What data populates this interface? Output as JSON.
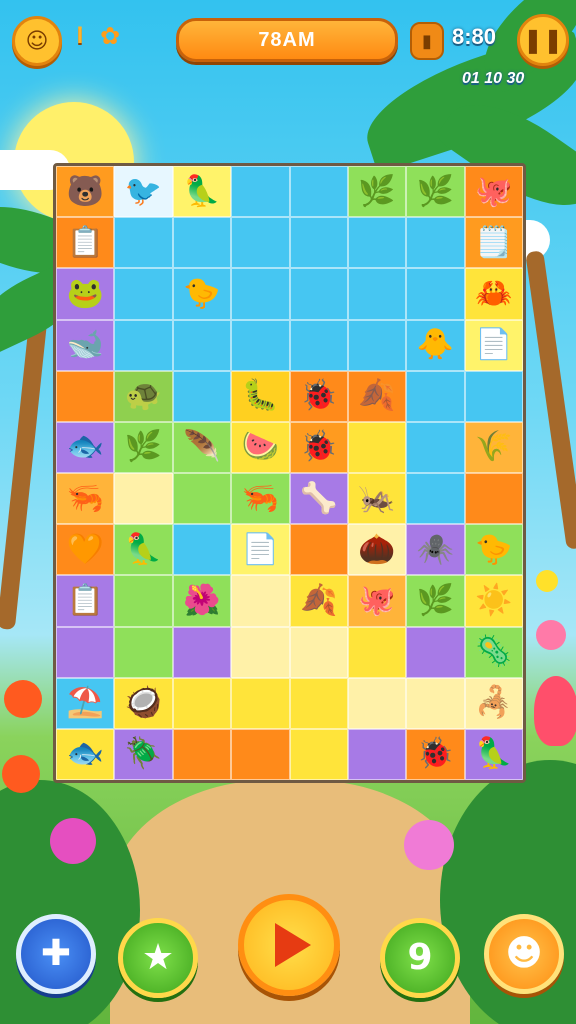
{
  "hud": {
    "profile_icon": "character-face-icon",
    "level_badge": "I",
    "gift_icon": "gift-icon",
    "title": "78AM",
    "lock_icon": "lock-icon",
    "time": "8:80",
    "pause_icon": "pause-icon",
    "stats": "01 10 30"
  },
  "board": {
    "rows": 12,
    "columns": 8,
    "cells": [
      [
        "#ff9b1f",
        "#e7f7ff",
        "#fff36a",
        "#46c6f2",
        "#46c6f2",
        "#8fe05a",
        "#8fe05a",
        "#ff8a1a"
      ],
      [
        "#ff8a1a",
        "#46c6f2",
        "#46c6f2",
        "#46c6f2",
        "#46c6f2",
        "#46c6f2",
        "#46c6f2",
        "#ff9b1f"
      ],
      [
        "#a77ae6",
        "#46c6f2",
        "#46c6f2",
        "#46c6f2",
        "#46c6f2",
        "#46c6f2",
        "#46c6f2",
        "#ffe43a"
      ],
      [
        "#a77ae6",
        "#46c6f2",
        "#46c6f2",
        "#46c6f2",
        "#46c6f2",
        "#46c6f2",
        "#46c6f2",
        "#fff36a"
      ],
      [
        "#ff8a1a",
        "#8fd04f",
        "#46c6f2",
        "#ffd020",
        "#ff8a1a",
        "#ff8a1a",
        "#46c6f2",
        "#46c6f2"
      ],
      [
        "#a77ae6",
        "#8fe05a",
        "#8fe05a",
        "#ffe43a",
        "#ff9b1f",
        "#ffe43a",
        "#46c6f2",
        "#ffb43a"
      ],
      [
        "#ffb43a",
        "#fff1a8",
        "#8fe05a",
        "#8fe05a",
        "#a77ae6",
        "#ffe43a",
        "#46c6f2",
        "#ff8a1a"
      ],
      [
        "#ff8a1a",
        "#8fe05a",
        "#46c6f2",
        "#fff36a",
        "#ff8a1a",
        "#fff1a8",
        "#a77ae6",
        "#8fe05a"
      ],
      [
        "#a77ae6",
        "#8fe05a",
        "#8fe05a",
        "#fff1a8",
        "#ffe43a",
        "#ffb43a",
        "#8fe05a",
        "#ffe43a"
      ],
      [
        "#a77ae6",
        "#8fe05a",
        "#a77ae6",
        "#fff1a8",
        "#fff1a8",
        "#ffe43a",
        "#a77ae6",
        "#8fe05a"
      ],
      [
        "#46c6f2",
        "#ffe43a",
        "#ffe43a",
        "#ffe43a",
        "#ffe43a",
        "#fff1a8",
        "#fff1a8",
        "#fff1a8"
      ],
      [
        "#ffe43a",
        "#a77ae6",
        "#ff8a1a",
        "#ff8a1a",
        "#ffe43a",
        "#a77ae6",
        "#ff8a1a",
        "#a77ae6"
      ]
    ],
    "pieces": [
      [
        "🐻",
        "🐦",
        "🦜",
        "",
        "",
        "🌿",
        "🌿",
        "🐙"
      ],
      [
        "📋",
        "",
        "",
        "",
        "",
        "",
        "",
        "🗒️"
      ],
      [
        "🐸",
        "",
        "🐤",
        "",
        "",
        "",
        "",
        "🦀"
      ],
      [
        "🐋",
        "",
        "",
        "",
        "",
        "",
        "🐥",
        "📄"
      ],
      [
        "",
        "🐢",
        "",
        "🐛",
        "🐞",
        "🍂",
        "",
        ""
      ],
      [
        "🐟",
        "🌿",
        "🪶",
        "🍉",
        "🐞",
        "",
        "",
        "🌾"
      ],
      [
        "🦐",
        "",
        "",
        "🦐",
        "🦴",
        "🦗",
        "",
        ""
      ],
      [
        "🧡",
        "🦜",
        "",
        "📄",
        "",
        "🌰",
        "🕷️",
        "🐤"
      ],
      [
        "📋",
        "",
        "🌺",
        "",
        "🍂",
        "🐙",
        "🌿",
        "☀️"
      ],
      [
        "",
        "",
        "",
        "",
        "",
        "",
        "",
        "🦠"
      ],
      [
        "⛱️",
        "🥥",
        "",
        "",
        "",
        "",
        "",
        "🦂"
      ],
      [
        "🐟",
        "🪲",
        "",
        "",
        "",
        "",
        "🐞",
        "🦜"
      ]
    ]
  },
  "bottom": {
    "puzzle_icon": "puzzle-piece-icon",
    "star_icon": "star-icon",
    "play_icon": "play-icon",
    "hint_icon": "hint-icon",
    "character_icon": "character-icon"
  },
  "colors": {
    "hud_gold": "#ffc12e",
    "title_orange": "#ff8a12",
    "play_red": "#e63b12",
    "puzzle_blue": "#2f6fe3",
    "green_button": "#55c12a",
    "orange_button": "#ff9d1a"
  }
}
